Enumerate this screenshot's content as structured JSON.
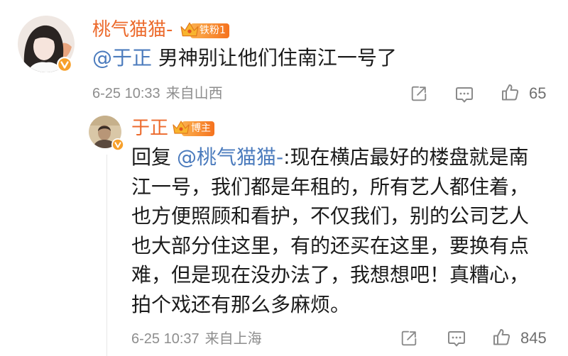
{
  "comment": {
    "author": "桃气猫猫-",
    "badge": "铁粉1",
    "mention": "@于正",
    "text": "男神别让他们住南江一号了",
    "time": "6-25 10:33",
    "source": "来自山西",
    "likes": "65"
  },
  "reply": {
    "author": "于正",
    "badge": "博主",
    "prefix": "回复",
    "mention": "@桃气猫猫-",
    "lines": [
      ":现在横店最好的楼盘就是南",
      "江一号，我们都是年租的，所有艺人都住着，",
      "也方便照顾和看护，不仅我们，别的公司艺人",
      "也大部分住这里，有的还买在这里，要换有点",
      "难，但是现在没办法了，我想想吧！真糟心，",
      "拍个戏还有那么多麻烦。"
    ],
    "time": "6-25 10:37",
    "source": "来自上海",
    "likes": "845"
  },
  "icons": {
    "verified": "verified-badge-icon",
    "crown": "crown-icon",
    "share": "share-icon",
    "comment": "comment-icon",
    "like": "like-icon"
  },
  "colors": {
    "name": "#ec6a2c",
    "link": "#4b7bbd",
    "meta": "#8e8e8e",
    "text": "#1b1b1b",
    "icon": "#8a8a8a",
    "badge_start": "#fbb04e",
    "badge_end": "#f5721e",
    "verified": "#f7a02b"
  }
}
